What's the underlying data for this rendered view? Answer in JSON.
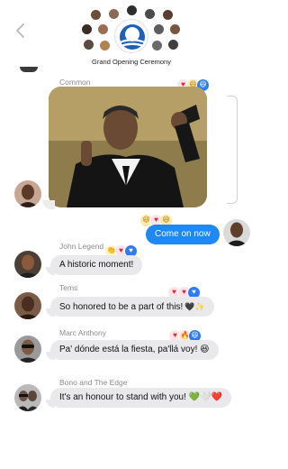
{
  "header": {
    "title": "Grand Opening Ceremony",
    "back_icon": "chevron-left-icon",
    "logo_icon": "brand-logo-icon"
  },
  "colors": {
    "outgoing_bubble": "#1e88f7",
    "incoming_bubble": "#e9e9eb",
    "heart": "#e0243d",
    "reaction_blue": "#2c7cf5"
  },
  "messages": [
    {
      "sender": "Common",
      "type": "photo",
      "reactions": [
        "heart",
        "laugh",
        "laugh-blue"
      ]
    },
    {
      "sender": "",
      "type": "text",
      "direction": "outgoing",
      "text": "Come on now",
      "reactions": [
        "laugh",
        "heart",
        "laugh"
      ]
    },
    {
      "sender": "John Legend",
      "type": "text",
      "direction": "incoming",
      "text": "A historic moment!",
      "reactions": [
        "clap",
        "heart",
        "heart-blue"
      ]
    },
    {
      "sender": "Tems",
      "type": "text",
      "direction": "incoming",
      "text": "So honored to be a part of this!",
      "emoji": "🖤✨",
      "reactions": [
        "heart",
        "heart",
        "heart-blue"
      ]
    },
    {
      "sender": "Marc Anthony",
      "type": "text",
      "direction": "incoming",
      "text": "Pa' dónde está la fiesta, pa'llá voy! 😆",
      "reactions": [
        "heart",
        "fire",
        "laugh-blue"
      ]
    },
    {
      "sender": "Bono and The Edge",
      "type": "text",
      "direction": "incoming",
      "text": "It's an honour to stand with you! 💚🤍❤️"
    }
  ]
}
